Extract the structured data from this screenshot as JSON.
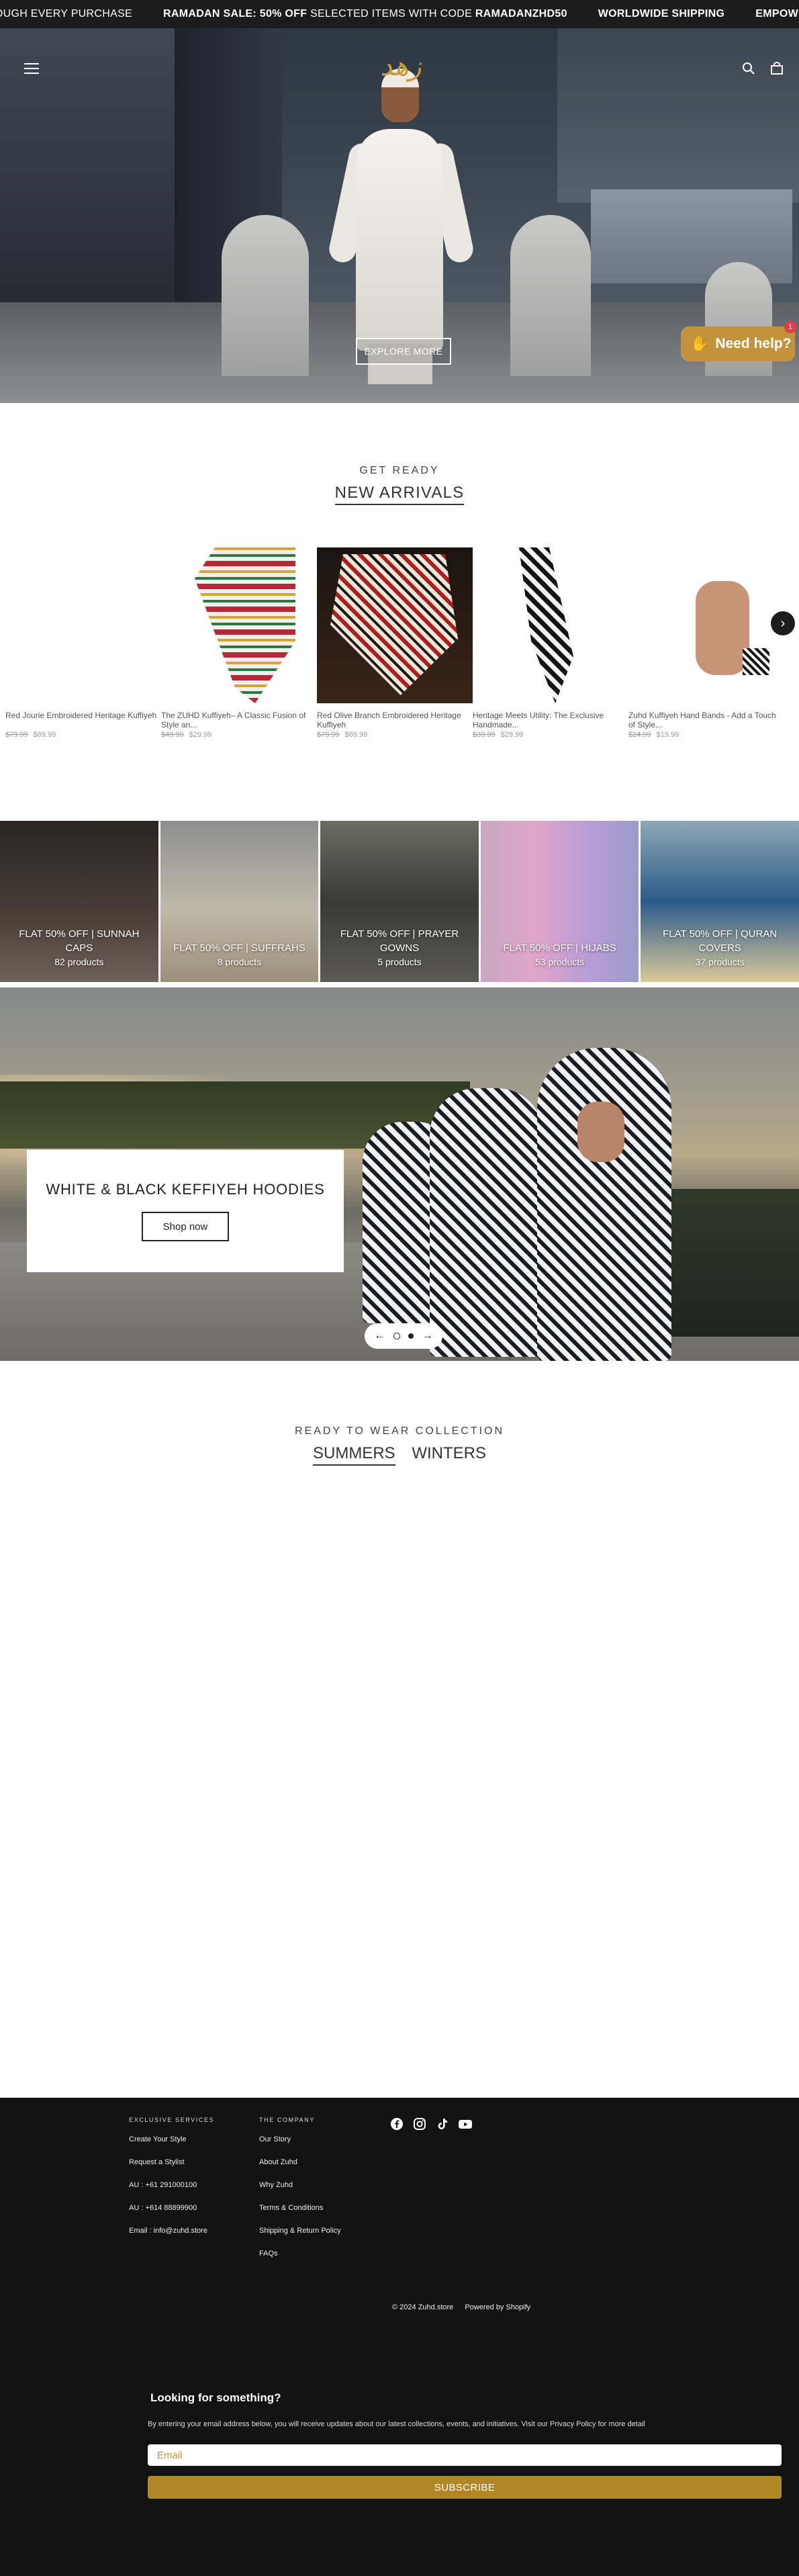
{
  "announcement": {
    "items": [
      {
        "bold": "",
        "text": "ROUGH EVERY PURCHASE"
      },
      {
        "bold": "RAMADAN SALE: 50% OFF",
        "text": " SELECTED ITEMS WITH CODE ",
        "bold2": "RAMADANZHD50"
      },
      {
        "bold": "WORLDWIDE SHIPPING",
        "text": ""
      },
      {
        "bold": "EMPOWER COMMU",
        "text": ""
      }
    ]
  },
  "header": {
    "logo_text": "زهد",
    "explore_label": "EXPLORE MORE"
  },
  "help_widget": {
    "label": "Need help?",
    "badge": "1"
  },
  "arrivals": {
    "subtitle": "GET READY",
    "title": "NEW ARRIVALS",
    "products": [
      {
        "name": "Red Jourie Embroidered Heritage Kuffiyeh",
        "old_price": "$79.99",
        "price": "$69.99"
      },
      {
        "name": "The ZUHD Kuffiyeh– A Classic Fusion of Style an...",
        "old_price": "$49.99",
        "price": "$29.99"
      },
      {
        "name": "Red Olive Branch Embroidered Heritage Kuffiyeh",
        "old_price": "$79.99",
        "price": "$69.99"
      },
      {
        "name": "Heritage Meets Utility: The Exclusive Handmade...",
        "old_price": "$39.99",
        "price": "$29.99"
      },
      {
        "name": "Zuhd Kuffiyeh Hand Bands - Add a Touch of Style...",
        "old_price": "$24.99",
        "price": "$19.99"
      }
    ]
  },
  "categories": [
    {
      "title": "FLAT 50% OFF | SUNNAH CAPS",
      "count": "82 products"
    },
    {
      "title": "FLAT 50% OFF | SUFFRAHS",
      "count": "8 products"
    },
    {
      "title": "FLAT 50% OFF | PRAYER GOWNS",
      "count": "5 products"
    },
    {
      "title": "FLAT 50% OFF | HIJABS",
      "count": "53 products"
    },
    {
      "title": "FLAT 50% OFF | QURAN COVERS",
      "count": "37 products"
    }
  ],
  "slideshow": {
    "heading": "WHITE & BLACK KEFFIYEH HOODIES",
    "button": "Shop now",
    "prev": "←",
    "next": "→"
  },
  "ready_to_wear": {
    "subtitle": "READY TO WEAR COLLECTION",
    "tabs": [
      "SUMMERS",
      "WINTERS"
    ]
  },
  "footer": {
    "col1": {
      "heading": "EXCLUSIVE SERVICES",
      "items": [
        "Create Your Style",
        "Request a Stylist",
        "AU : +61 291000100",
        "AU : +614 88899900",
        "Email : info@zuhd.store"
      ]
    },
    "col2": {
      "heading": "THE COMPANY",
      "items": [
        "Our Story",
        "About Zuhd",
        "Why Zuhd",
        "Terms & Conditions",
        "Shipping & Return Policy",
        "FAQs"
      ]
    },
    "copyright": "© 2024 Zuhd.store",
    "powered": "Powered by Shopify"
  },
  "newsletter": {
    "title": "Looking for something?",
    "text": "By entering your email address below, you will receive updates about our latest collections, events, and initiatives. Visit our Privacy Policy for more detail",
    "placeholder": "Email",
    "button": "SUBSCRIBE"
  }
}
